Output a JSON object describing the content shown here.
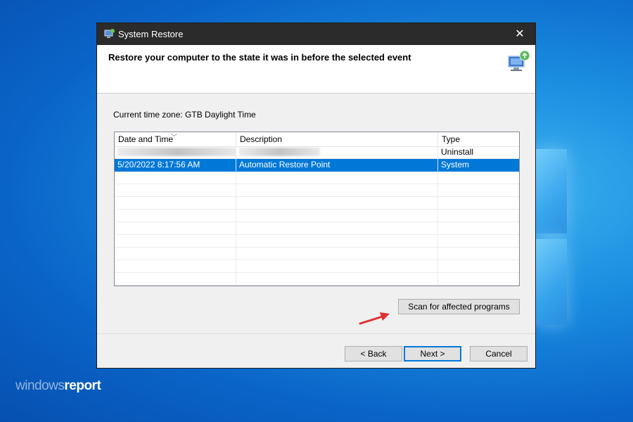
{
  "window": {
    "title": "System Restore",
    "close_glyph": "✕"
  },
  "header": {
    "title": "Restore your computer to the state it was in before the selected event",
    "icon": "computer-restore-icon"
  },
  "timezone": {
    "label": "Current time zone: GTB Daylight Time"
  },
  "table": {
    "columns": [
      "Date and Time",
      "Description",
      "Type"
    ],
    "sort_glyph": "﹀",
    "rows": [
      {
        "date": "",
        "description": "",
        "type": "Uninstall",
        "redacted": true,
        "selected": false
      },
      {
        "date": "5/20/2022 8:17:56 AM",
        "description": "Automatic Restore Point",
        "type": "System",
        "redacted": false,
        "selected": true
      }
    ]
  },
  "buttons": {
    "scan": "Scan for affected programs",
    "back": "< Back",
    "next": "Next >",
    "cancel": "Cancel"
  },
  "watermark": {
    "part1": "windows",
    "part2": "report"
  },
  "colors": {
    "selection": "#0078d7",
    "arrow": "#e03030",
    "titlebar": "#2b2b2b"
  }
}
